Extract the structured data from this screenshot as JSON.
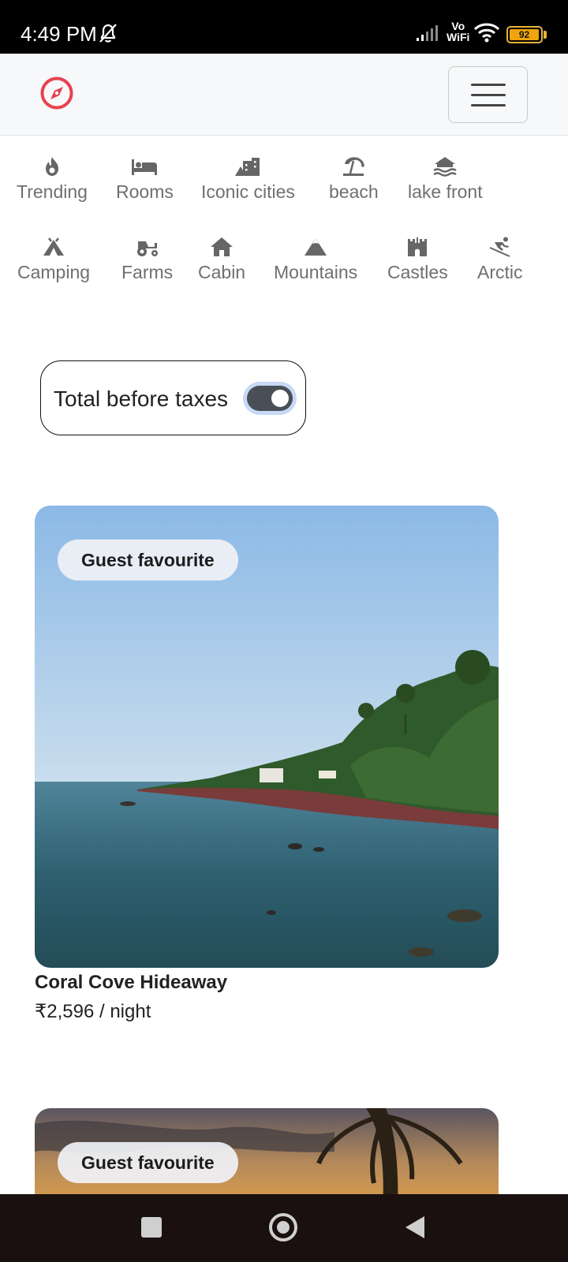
{
  "status_bar": {
    "time": "4:49 PM",
    "network_label_top": "Vo",
    "network_label_bottom": "WiFi",
    "battery_level": "92"
  },
  "header": {
    "logo_icon": "compass-icon",
    "menu_icon": "hamburger-menu-icon",
    "accent_color": "#e8424f"
  },
  "categories": {
    "row1": [
      {
        "label": "Trending",
        "icon": "flame-icon"
      },
      {
        "label": "Rooms",
        "icon": "bed-icon"
      },
      {
        "label": "Iconic cities",
        "icon": "city-buildings-icon"
      },
      {
        "label": "beach",
        "icon": "umbrella-beach-icon"
      },
      {
        "label": "lake front",
        "icon": "water-house-icon"
      }
    ],
    "row2": [
      {
        "label": "Camping",
        "icon": "tent-icon"
      },
      {
        "label": "Farms",
        "icon": "tractor-icon"
      },
      {
        "label": "Cabin",
        "icon": "house-icon"
      },
      {
        "label": "Mountains",
        "icon": "mountain-icon"
      },
      {
        "label": "Castles",
        "icon": "castle-icon"
      },
      {
        "label": "Arctic",
        "icon": "skiing-icon"
      }
    ]
  },
  "tax_toggle": {
    "label": "Total before taxes",
    "on": true
  },
  "listings": [
    {
      "badge": "Guest favourite",
      "title": "Coral Cove Hideaway",
      "price": "₹2,596 / night"
    },
    {
      "badge": "Guest favourite"
    }
  ]
}
